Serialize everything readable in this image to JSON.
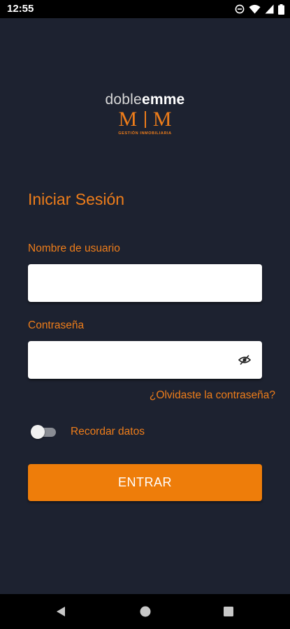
{
  "status_bar": {
    "time": "12:55",
    "icons": [
      "dnd-icon",
      "wifi-icon",
      "signal-icon",
      "battery-icon"
    ]
  },
  "logo": {
    "word_light": "doble",
    "word_bold": "emme",
    "mark_left": "M",
    "mark_right": "M",
    "tagline": "GESTIÓN INMOBILIARIA"
  },
  "login": {
    "title": "Iniciar Sesión",
    "username_label": "Nombre de usuario",
    "username_value": "",
    "password_label": "Contraseña",
    "password_value": "",
    "forgot_password": "¿Olvidaste la contraseña?",
    "remember_label": "Recordar datos",
    "remember_checked": false,
    "submit_label": "ENTRAR"
  },
  "nav_bar": {
    "buttons": [
      "back-icon",
      "home-icon",
      "recents-icon"
    ]
  },
  "colors": {
    "background": "#1d2230",
    "accent": "#ee7d1a",
    "button": "#ee7d0a",
    "input_background": "#ffffff",
    "system_bar": "#000000"
  }
}
